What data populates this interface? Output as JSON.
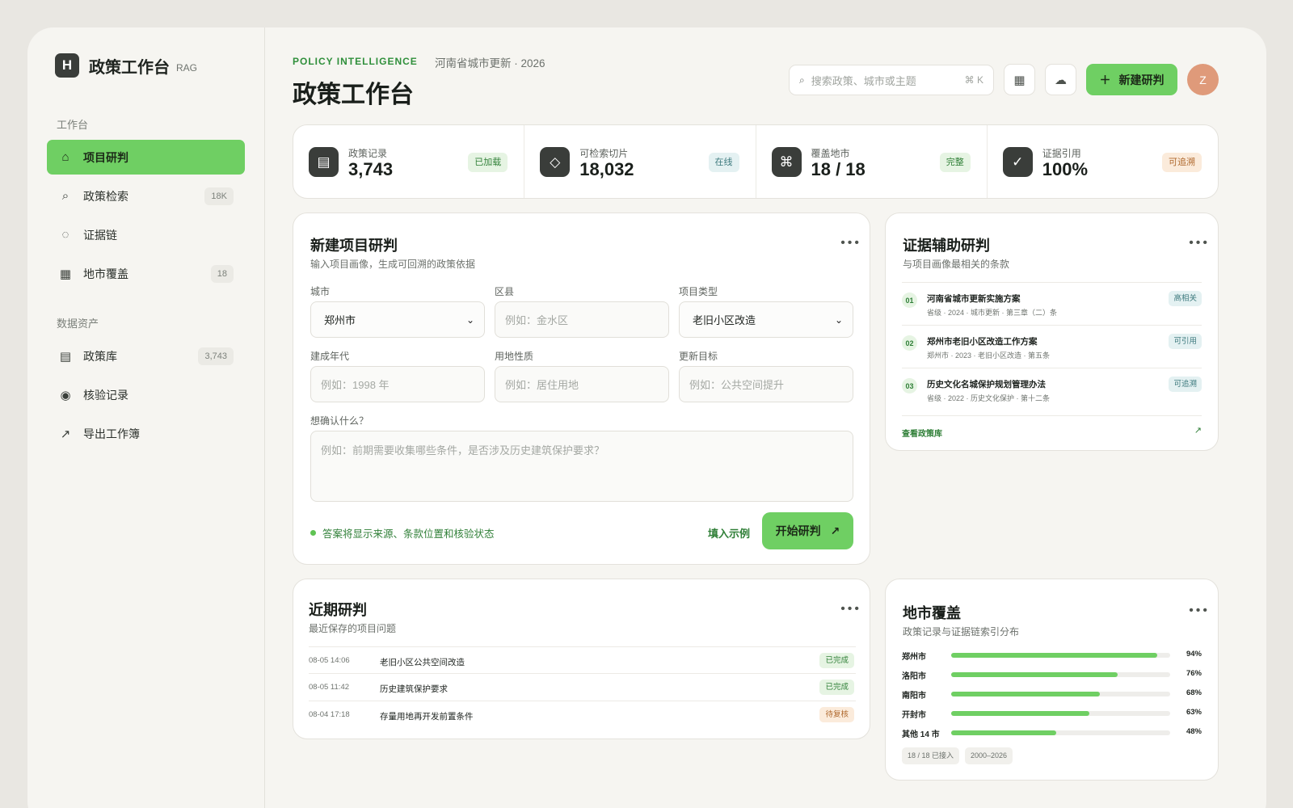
{
  "brand": {
    "logo": "H",
    "title": "政策工作台",
    "tag": "RAG"
  },
  "sidebar": {
    "section_workbench": "工作台",
    "section_assets": "数据资产",
    "items": [
      {
        "label": "项目研判",
        "icon": "home-icon",
        "badge": ""
      },
      {
        "label": "政策检索",
        "icon": "search-icon",
        "badge": "18K"
      },
      {
        "label": "证据链",
        "icon": "dashed-circle-icon",
        "badge": ""
      },
      {
        "label": "地市覆盖",
        "icon": "grid-icon",
        "badge": "18"
      },
      {
        "label": "政策库",
        "icon": "list-icon",
        "badge": "3,743"
      },
      {
        "label": "核验记录",
        "icon": "radio-dot-icon",
        "badge": ""
      },
      {
        "label": "导出工作簿",
        "icon": "arrow-up-right-icon",
        "badge": ""
      }
    ]
  },
  "header": {
    "eyebrow": "POLICY INTELLIGENCE",
    "context": "河南省城市更新 · 2026",
    "title": "政策工作台",
    "search_placeholder": "搜索政策、城市或主题",
    "search_shortcut": "⌘ K",
    "new_button": "新建研判",
    "avatar": "Z"
  },
  "stats": [
    {
      "label": "政策记录",
      "value": "3,743",
      "chip": "已加载",
      "icon": "document-icon"
    },
    {
      "label": "可检索切片",
      "value": "18,032",
      "chip": "在线",
      "icon": "diamond-icon"
    },
    {
      "label": "覆盖地市",
      "value": "18 / 18",
      "chip": "完整",
      "icon": "command-icon"
    },
    {
      "label": "证据引用",
      "value": "100%",
      "chip": "可追溯",
      "icon": "check-icon"
    }
  ],
  "new_project": {
    "title": "新建项目研判",
    "subtitle": "输入项目画像，生成可回溯的政策依据",
    "city_label": "城市",
    "city_value": "郑州市",
    "district_label": "区县",
    "district_placeholder": "例如：金水区",
    "type_label": "项目类型",
    "type_value": "老旧小区改造",
    "year_label": "建成年代",
    "year_placeholder": "例如：1998 年",
    "land_label": "用地性质",
    "land_placeholder": "例如：居住用地",
    "goal_label": "更新目标",
    "goal_placeholder": "例如：公共空间提升",
    "question_label": "想确认什么？",
    "question_placeholder": "例如：前期需要收集哪些条件，是否涉及历史建筑保护要求？",
    "hint": "答案将显示来源、条款位置和核验状态",
    "fill_example": "填入示例",
    "start_button": "开始研判"
  },
  "evidence": {
    "title": "证据辅助研判",
    "subtitle": "与项目画像最相关的条款",
    "items": [
      {
        "num": "01",
        "title": "河南省城市更新实施方案",
        "meta": "省级 · 2024 · 城市更新 · 第三章（二）条",
        "chip": "高相关"
      },
      {
        "num": "02",
        "title": "郑州市老旧小区改造工作方案",
        "meta": "郑州市 · 2023 · 老旧小区改造 · 第五条",
        "chip": "可引用"
      },
      {
        "num": "03",
        "title": "历史文化名城保护规划管理办法",
        "meta": "省级 · 2022 · 历史文化保护 · 第十二条",
        "chip": "可追溯"
      }
    ],
    "footer_link": "查看政策库"
  },
  "recent": {
    "title": "近期研判",
    "subtitle": "最近保存的项目问题",
    "rows": [
      {
        "time": "08-05 14:06",
        "title": "老旧小区公共空间改造",
        "status": "已完成"
      },
      {
        "time": "08-05 11:42",
        "title": "历史建筑保护要求",
        "status": "已完成"
      },
      {
        "time": "08-04 17:18",
        "title": "存量用地再开发前置条件",
        "status": "待复核"
      }
    ]
  },
  "coverage": {
    "title": "地市覆盖",
    "subtitle": "政策记录与证据链索引分布",
    "rows": [
      {
        "name": "郑州市",
        "pct": 94,
        "label": "94%"
      },
      {
        "name": "洛阳市",
        "pct": 76,
        "label": "76%"
      },
      {
        "name": "南阳市",
        "pct": 68,
        "label": "68%"
      },
      {
        "name": "开封市",
        "pct": 63,
        "label": "63%"
      },
      {
        "name": "其他 14 市",
        "pct": 48,
        "label": "48%"
      }
    ],
    "tag_connected": "18 / 18 已接入",
    "tag_years": "2000–2026"
  },
  "colors": {
    "accent": "#6fcf63",
    "accent_text": "#2f7f37",
    "dark": "#3a3d3a"
  }
}
